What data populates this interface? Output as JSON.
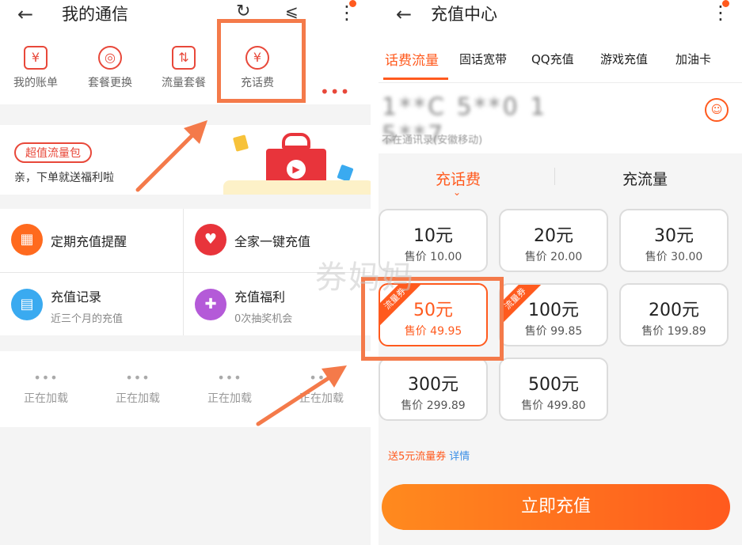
{
  "left": {
    "header": {
      "title": "我的通信"
    },
    "quick_actions": [
      {
        "label": "我的账单",
        "glyph": "¥"
      },
      {
        "label": "套餐更换",
        "glyph": "◎"
      },
      {
        "label": "流量套餐",
        "glyph": "⇅"
      },
      {
        "label": "充话费",
        "glyph": "¥"
      }
    ],
    "more_glyph": "•••",
    "banner": {
      "pill": "超值流量包",
      "subtitle": "亲，下单就送福利啦",
      "play_glyph": "▶"
    },
    "services": [
      {
        "title": "定期充值提醒",
        "subtitle": "",
        "color": "#ff6a1e",
        "glyph": "▦"
      },
      {
        "title": "全家一键充值",
        "subtitle": "",
        "color": "#e8343b",
        "glyph": "♥"
      },
      {
        "title": "充值记录",
        "subtitle": "近三个月的充值",
        "color": "#3aaaf0",
        "glyph": "▤"
      },
      {
        "title": "充值福利",
        "subtitle": "0次抽奖机会",
        "color": "#b45ad8",
        "glyph": "✚"
      }
    ],
    "loading": {
      "dots": "•••",
      "label": "正在加载",
      "count": 4
    }
  },
  "right": {
    "header": {
      "title": "充值中心"
    },
    "tabs": [
      "话费流量",
      "固话宽带",
      "QQ充值",
      "游戏充值",
      "加油卡"
    ],
    "phone": {
      "number": "1**C 5**0 1 5**7",
      "note": "不在通讯录(安徽移动)"
    },
    "subtabs": [
      "充话费",
      "充流量"
    ],
    "cards": [
      {
        "amount": "10元",
        "price": "售价 10.00",
        "ribbon": ""
      },
      {
        "amount": "20元",
        "price": "售价 20.00",
        "ribbon": ""
      },
      {
        "amount": "30元",
        "price": "售价 30.00",
        "ribbon": ""
      },
      {
        "amount": "50元",
        "price": "售价 49.95",
        "ribbon": "流量券"
      },
      {
        "amount": "100元",
        "price": "售价 99.85",
        "ribbon": "流量券"
      },
      {
        "amount": "200元",
        "price": "售价 199.89",
        "ribbon": ""
      },
      {
        "amount": "300元",
        "price": "售价 299.89",
        "ribbon": ""
      },
      {
        "amount": "500元",
        "price": "售价 499.80",
        "ribbon": ""
      }
    ],
    "promo": {
      "text": "送5元流量券",
      "link": "详情"
    },
    "cta": "立即充值"
  },
  "watermark": "券妈妈",
  "colors": {
    "accent": "#ff5a1e",
    "highlight": "#f47a4a",
    "link": "#3a8ee6"
  },
  "icons": {
    "back": "←",
    "refresh": "↻",
    "share": "⩽",
    "menu": "⋮",
    "contact": "☺",
    "caret": "⌄"
  }
}
